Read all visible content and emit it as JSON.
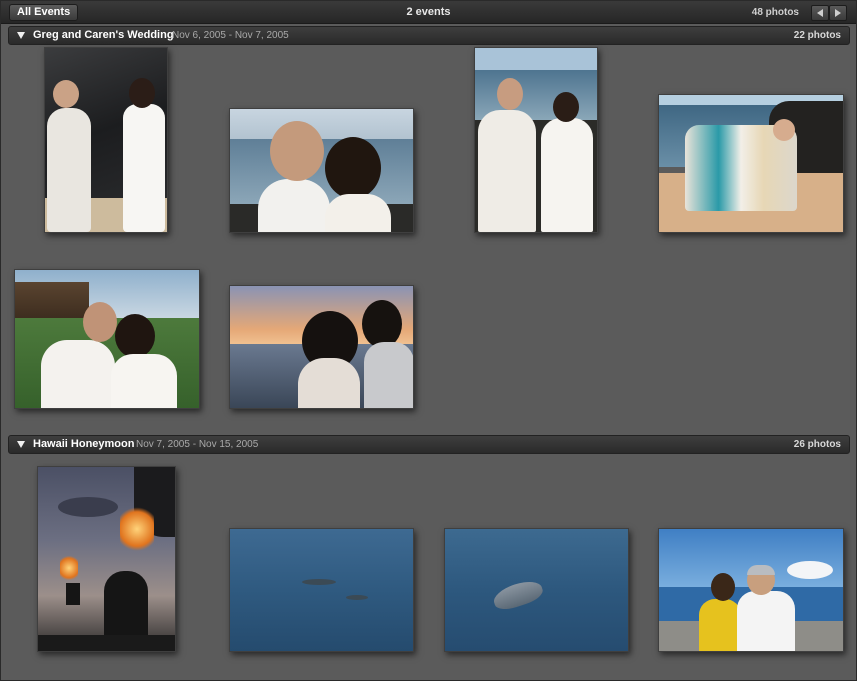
{
  "toolbar": {
    "all_events_label": "All Events",
    "title": "2 events",
    "photo_total": "48 photos"
  },
  "events": [
    {
      "title": "Greg and Caren's Wedding",
      "dates": "Nov 6, 2005 - Nov 7, 2005",
      "count": "22 photos",
      "photos": [
        {
          "subject": "couple-rocks-portrait"
        },
        {
          "subject": "couple-kiss-ocean"
        },
        {
          "subject": "couple-beach-leis"
        },
        {
          "subject": "group-on-beach"
        },
        {
          "subject": "couple-lawn-palms"
        },
        {
          "subject": "couple-sunset"
        }
      ]
    },
    {
      "title": "Hawaii Honeymoon",
      "dates": "Nov 7, 2005 - Nov 15, 2005",
      "count": "26 photos",
      "photos": [
        {
          "subject": "tiki-torches-dusk"
        },
        {
          "subject": "dolphins-ocean"
        },
        {
          "subject": "dolphin-closeup"
        },
        {
          "subject": "couple-boat-deck"
        }
      ]
    }
  ],
  "colors": {
    "background": "#5a5a5a",
    "toolbar": "#2b2b2b",
    "header": "#333333",
    "header_text": "#ffffff",
    "date_text": "#a9a9a9"
  },
  "icons": [
    "disclosure-triangle-icon",
    "arrow-left-icon",
    "arrow-right-icon"
  ]
}
